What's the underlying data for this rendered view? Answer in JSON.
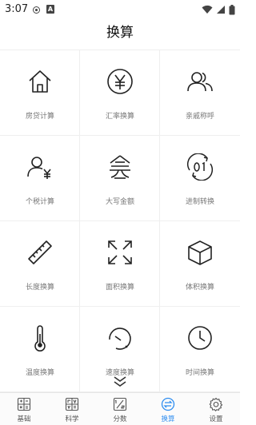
{
  "status_bar": {
    "time": "3:07",
    "indicator": "A"
  },
  "title": "换算",
  "accent_color": "#2f8ef0",
  "grid_items": [
    {
      "label": "房贷计算",
      "icon": "house-icon"
    },
    {
      "label": "汇率换算",
      "icon": "yen-circle-icon"
    },
    {
      "label": "亲戚称呼",
      "icon": "people-icon"
    },
    {
      "label": "个税计算",
      "icon": "person-yen-icon"
    },
    {
      "label": "大写金额",
      "icon": "chinese-numeral-icon"
    },
    {
      "label": "进制转换",
      "icon": "binary-cycle-icon"
    },
    {
      "label": "长度换算",
      "icon": "ruler-icon"
    },
    {
      "label": "面积换算",
      "icon": "expand-arrows-icon"
    },
    {
      "label": "体积换算",
      "icon": "cube-icon"
    },
    {
      "label": "温度换算",
      "icon": "thermometer-icon"
    },
    {
      "label": "速度换算",
      "icon": "speedometer-icon"
    },
    {
      "label": "时间换算",
      "icon": "clock-icon"
    }
  ],
  "bottom_nav": [
    {
      "label": "基础",
      "icon": "calculator-icon",
      "active": false
    },
    {
      "label": "科学",
      "icon": "scientific-calculator-icon",
      "active": false
    },
    {
      "label": "分数",
      "icon": "fraction-icon",
      "active": false
    },
    {
      "label": "换算",
      "icon": "exchange-icon",
      "active": true
    },
    {
      "label": "设置",
      "icon": "gear-icon",
      "active": false
    }
  ]
}
